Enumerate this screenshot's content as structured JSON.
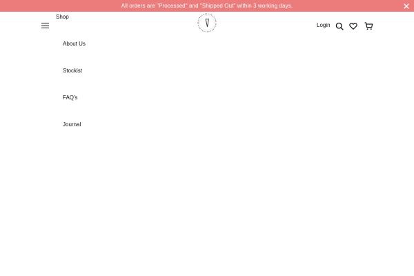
{
  "announcement": {
    "text": "All orders are \"Processed\" and \"Shipped Out\" within 3 working days.",
    "close_icon": "close-icon",
    "background": "#ec7b7c"
  },
  "header": {
    "menu_icon": "hamburger-menu-icon",
    "logo": "brand-logo",
    "login_label": "Login",
    "icons": [
      "search-icon",
      "heart-icon",
      "cart-icon"
    ]
  },
  "menu": {
    "items": [
      {
        "label": "Shop"
      },
      {
        "label": "About Us"
      },
      {
        "label": "Stockist"
      },
      {
        "label": "FAQ's"
      },
      {
        "label": "Journal"
      }
    ]
  }
}
